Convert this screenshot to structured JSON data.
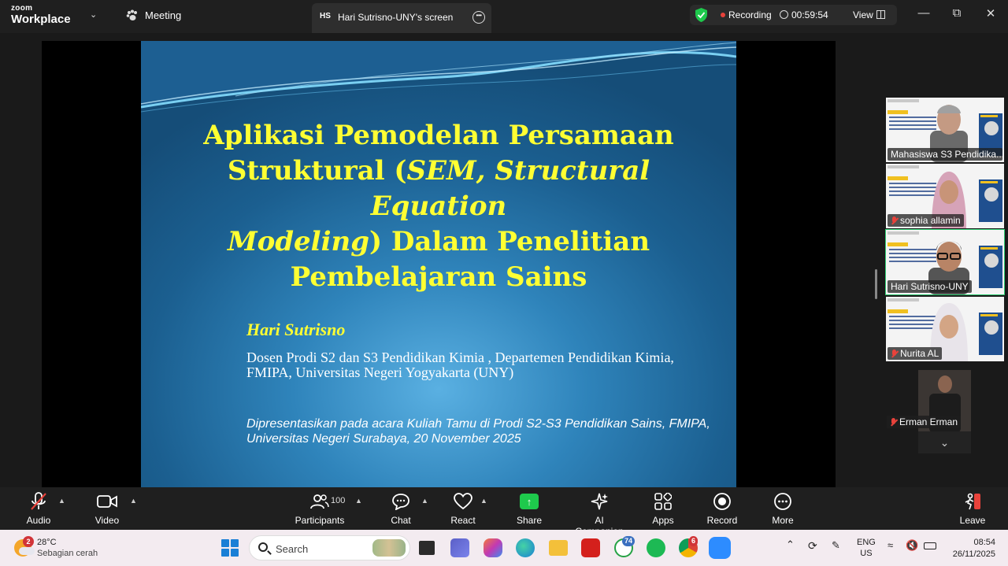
{
  "app": {
    "logo_line1": "zoom",
    "logo_line2": "Workplace",
    "meeting_label": "Meeting",
    "share_tab_initials": "HS",
    "share_tab_title": "Hari Sutrisno-UNY's screen"
  },
  "status": {
    "recording_label": "Recording",
    "timer": "00:59:54",
    "view_label": "View"
  },
  "slide": {
    "title_line1": "Aplikasi Pemodelan Persamaan",
    "title_line2_a": "Struktural (",
    "title_line2_b": "SEM, Structural Equation",
    "title_line3_a": "Modeling",
    "title_line3_b": ") Dalam Penelitian",
    "title_line4": "Pembelajaran Sains",
    "author": "Hari Sutrisno",
    "affiliation": "Dosen Prodi S2 dan S3 Pendidikan Kimia , Departemen Pendidikan Kimia, FMIPA,  Universitas Negeri Yogyakarta (UNY)",
    "presented": "Dipresentasikan pada acara Kuliah Tamu di Prodi S2-S3 Pendidikan Sains, FMIPA, Universitas Negeri Surabaya, 20 November 2025"
  },
  "participants": [
    {
      "name": "Mahasiswa S3 Pendidika...",
      "muted": false,
      "active": false
    },
    {
      "name": "sophia allamin",
      "muted": true,
      "active": false
    },
    {
      "name": "Hari Sutrisno-UNY",
      "muted": false,
      "active": true
    },
    {
      "name": "Nurita AL",
      "muted": true,
      "active": false
    },
    {
      "name": "Erman Erman",
      "muted": true,
      "active": false
    }
  ],
  "toolbar": {
    "audio": "Audio",
    "video": "Video",
    "participants": "Participants",
    "participants_count": "100",
    "chat": "Chat",
    "react": "React",
    "share": "Share",
    "ai_companion": "AI Companion",
    "apps": "Apps",
    "record": "Record",
    "more": "More",
    "leave": "Leave"
  },
  "taskbar": {
    "weather_badge": "2",
    "temperature": "28°C",
    "condition": "Sebagian cerah",
    "search_placeholder": "Search",
    "whatsapp_badge": "74",
    "chrome_badge": "6",
    "lang_line1": "ENG",
    "lang_line2": "US",
    "time": "08:54",
    "date": "26/11/2025"
  },
  "colors": {
    "accent_green": "#2ecc71",
    "share_green": "#1ec94c",
    "recording_red": "#e8423b",
    "slide_title_yellow": "#ffff33"
  }
}
